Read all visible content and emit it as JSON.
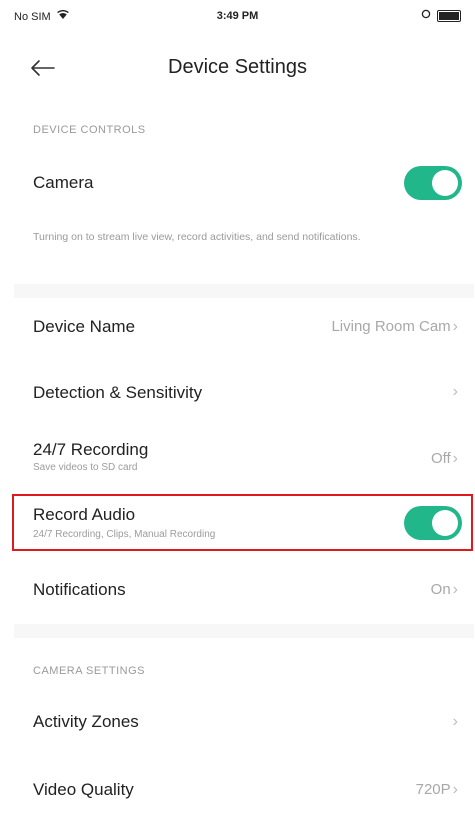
{
  "status_bar": {
    "carrier": "No SIM",
    "time": "3:49 PM"
  },
  "header": {
    "title": "Device Settings"
  },
  "device_controls": {
    "section_label": "DEVICE CONTROLS",
    "camera": {
      "label": "Camera",
      "on": true
    },
    "camera_description": "Turning on to stream live view, record activities, and send notifications."
  },
  "settings": {
    "device_name": {
      "label": "Device Name",
      "value": "Living Room Cam",
      "chevron": "›"
    },
    "detection": {
      "label": "Detection & Sensitivity",
      "chevron": "›"
    },
    "recording": {
      "label": "24/7 Recording",
      "subtitle": "Save videos to SD card",
      "value": "Off",
      "chevron": "›"
    },
    "record_audio": {
      "label": "Record Audio",
      "subtitle": "24/7 Recording, Clips, Manual Recording",
      "on": true
    },
    "notifications": {
      "label": "Notifications",
      "value": "On",
      "chevron": "›"
    }
  },
  "camera_settings": {
    "section_label": "CAMERA SETTINGS",
    "activity_zones": {
      "label": "Activity Zones",
      "chevron": "›"
    },
    "video_quality": {
      "label": "Video Quality",
      "value": "720P",
      "chevron": "›"
    }
  },
  "colors": {
    "accent": "#22b68b",
    "highlight": "#e0191d"
  },
  "icons": {
    "back": "back-arrow-icon",
    "wifi": "wifi-icon",
    "battery": "battery-icon"
  }
}
